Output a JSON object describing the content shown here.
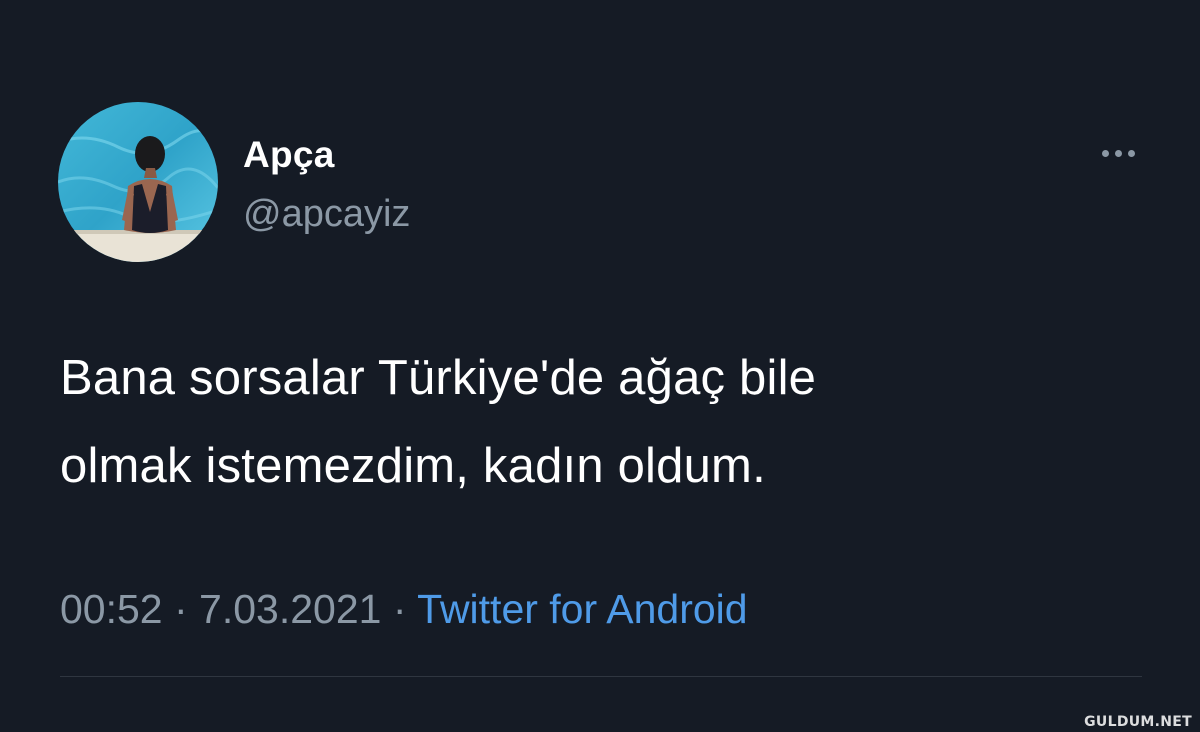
{
  "tweet": {
    "author": {
      "display_name": "Apça",
      "handle": "@apcayiz",
      "avatar": "avatar-photo-woman-at-pool"
    },
    "more_icon": "more-horizontal-icon",
    "text_lines": [
      "Bana sorsalar Türkiye'de ağaç bile",
      "olmak istemezdim, kadın oldum."
    ],
    "meta": {
      "time": "00:52",
      "separator": " · ",
      "date": "7.03.2021",
      "source": "Twitter for Android"
    }
  },
  "watermark": "GULDUM.NET",
  "colors": {
    "background": "#151b25",
    "primary_text": "#ffffff",
    "secondary_text": "#8b98a5",
    "link": "#4f9be8",
    "divider": "#2f3640"
  }
}
